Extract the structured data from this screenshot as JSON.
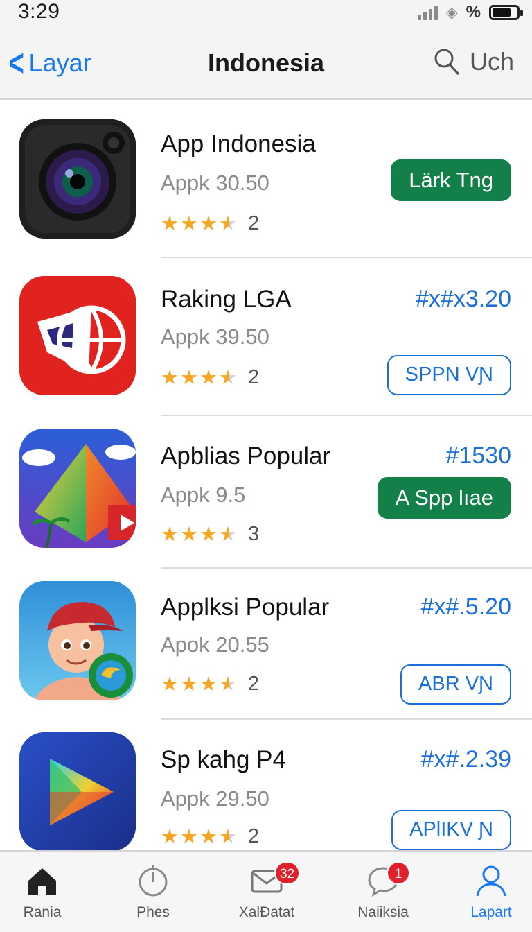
{
  "status_bar": {
    "time": "3:29"
  },
  "nav": {
    "back_label": "Layar",
    "title": "Indonesia",
    "search_label": "Uch"
  },
  "apps": [
    {
      "name": "App Indonesia",
      "subtitle": "Appk 30.50",
      "rating": 3.5,
      "rating_count": "2",
      "price": "",
      "button_label": "Lärk Tng",
      "button_style": "filled",
      "icon": "camera-icon"
    },
    {
      "name": "Raking  LGA",
      "subtitle": "Appk 39.50",
      "rating": 3.5,
      "rating_count": "2",
      "price": "#x#x3.20",
      "button_label": "SPPN VƝ",
      "button_style": "outline",
      "icon": "globe-flag-icon"
    },
    {
      "name": "Apblias Popular",
      "subtitle": "Appk 9.5",
      "rating": 3.5,
      "rating_count": "3",
      "price": "#1530",
      "button_label": "A Spp lıae",
      "button_style": "filled",
      "icon": "pyramid-icon"
    },
    {
      "name": "Applksi Popular",
      "subtitle": "Apok 20.55",
      "rating": 3.5,
      "rating_count": "2",
      "price": "#x#.5.20",
      "button_label": "ABR VƝ",
      "button_style": "outline",
      "icon": "cartoon-boy-icon"
    },
    {
      "name": "Sp kahg P4",
      "subtitle": "Appk 29.50",
      "rating": 3.5,
      "rating_count": "2",
      "price": "#x#.2.39",
      "button_label": "APlIKV Ɲ",
      "button_style": "outline",
      "icon": "play-triangle-icon"
    }
  ],
  "tabs": [
    {
      "label": "Rania",
      "icon": "home-icon",
      "badge": ""
    },
    {
      "label": "Phes",
      "icon": "clock-icon",
      "badge": ""
    },
    {
      "label": "XalÐatat",
      "icon": "mail-icon",
      "badge": "32"
    },
    {
      "label": "Naiiksia",
      "icon": "chat-icon",
      "badge": "1"
    },
    {
      "label": "Lapart",
      "icon": "person-icon",
      "badge": "",
      "active": true
    }
  ],
  "colors": {
    "accent": "#1877f2",
    "green_button": "#13804a",
    "price_blue": "#1a6fd9",
    "star": "#f5a623",
    "badge": "#e0202a"
  }
}
